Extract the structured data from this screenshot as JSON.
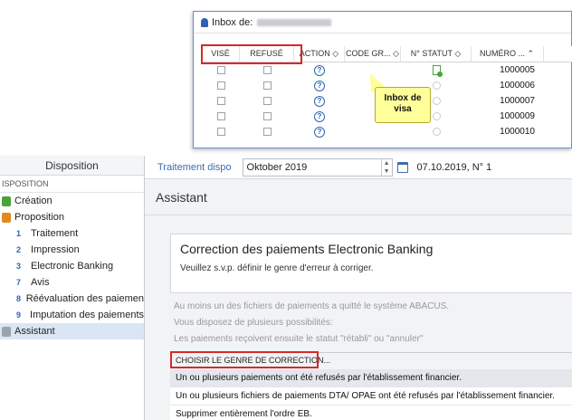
{
  "inbox": {
    "title": "Inbox de:",
    "columns": [
      "VISÉ",
      "REFUSÉ",
      "ACTION ◇",
      "CODE GR... ◇",
      "N° STATUT ◇",
      "NUMÉRO ... ⌃"
    ],
    "rows": [
      {
        "numero": "1000005"
      },
      {
        "numero": "1000006"
      },
      {
        "numero": "1000007"
      },
      {
        "numero": "1000009"
      },
      {
        "numero": "1000010"
      }
    ],
    "callout": "Inbox de visa"
  },
  "sidebar": {
    "header": "Disposition",
    "section": "ISPOSITION",
    "items": [
      {
        "num": "",
        "label": "Création"
      },
      {
        "num": "",
        "label": "Proposition"
      },
      {
        "num": "1",
        "label": "Traitement"
      },
      {
        "num": "2",
        "label": "Impression"
      },
      {
        "num": "3",
        "label": "Electronic Banking"
      },
      {
        "num": "7",
        "label": "Avis"
      },
      {
        "num": "8",
        "label": "Réévaluation des paiemen"
      },
      {
        "num": "9",
        "label": "Imputation des paiements"
      },
      {
        "num": "",
        "label": "Assistant"
      }
    ]
  },
  "toolbar": {
    "link": "Traitement dispo",
    "period": "Oktober  2019",
    "date": "07.10.2019, N° 1"
  },
  "assistant": {
    "title": "Assistant",
    "card_title": "Correction des paiements Electronic Banking",
    "card_text": "Veuillez s.v.p. définir le genre d'erreur à corriger.",
    "info": [
      "Au moins un des fichiers de paiements a quitté le système ABACUS.",
      "Vous disposez de plusieurs possibilités:",
      "Les paiements reçoivent ensuite le statut \"rétabli\" ou \"annuler\""
    ],
    "choose_label": "CHOISIR LE GENRE DE CORRECTION...",
    "options": [
      "Un ou plusieurs paiements ont été refusés par l'établissement financier.",
      "Un ou plusieurs fichiers de paiements DTA/ OPAE ont été refusés par l'établissement financier.",
      "Supprimer entièrement l'ordre EB."
    ]
  }
}
